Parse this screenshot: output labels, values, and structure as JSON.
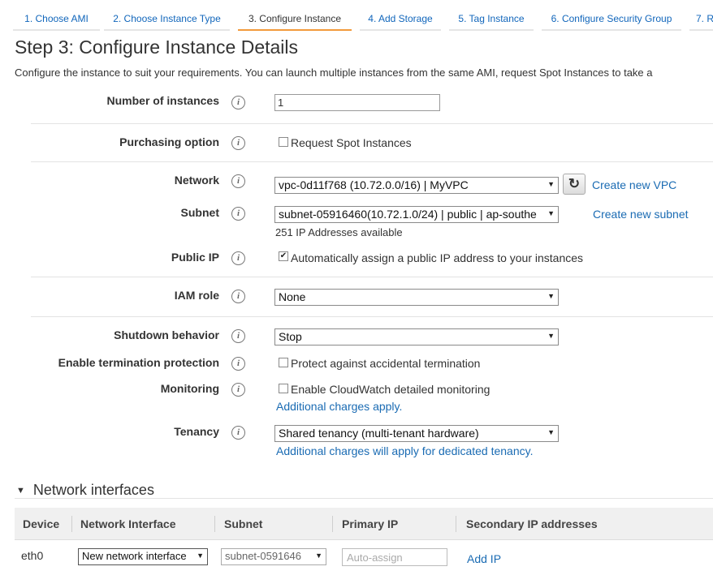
{
  "wizard_tabs": [
    {
      "label": "1. Choose AMI"
    },
    {
      "label": "2. Choose Instance Type"
    },
    {
      "label": "3. Configure Instance"
    },
    {
      "label": "4. Add Storage"
    },
    {
      "label": "5. Tag Instance"
    },
    {
      "label": "6. Configure Security Group"
    },
    {
      "label": "7. R"
    }
  ],
  "page": {
    "title": "Step 3: Configure Instance Details",
    "description": "Configure the instance to suit your requirements. You can launch multiple instances from the same AMI, request Spot Instances to take a"
  },
  "form": {
    "number_of_instances": {
      "label": "Number of instances",
      "value": "1"
    },
    "purchasing_option": {
      "label": "Purchasing option",
      "checkbox_label": "Request Spot Instances",
      "checked": false
    },
    "network": {
      "label": "Network",
      "selected": "vpc-0d11f768 (10.72.0.0/16) | MyVPC",
      "create_link": "Create new VPC"
    },
    "subnet": {
      "label": "Subnet",
      "selected": "subnet-05916460(10.72.1.0/24) | public | ap-southe",
      "create_link": "Create new subnet",
      "available": "251 IP Addresses available"
    },
    "public_ip": {
      "label": "Public IP",
      "checkbox_label": "Automatically assign a public IP address to your instances",
      "checked": true
    },
    "iam_role": {
      "label": "IAM role",
      "selected": "None"
    },
    "shutdown_behavior": {
      "label": "Shutdown behavior",
      "selected": "Stop"
    },
    "termination_protection": {
      "label": "Enable termination protection",
      "checkbox_label": "Protect against accidental termination",
      "checked": false
    },
    "monitoring": {
      "label": "Monitoring",
      "checkbox_label": "Enable CloudWatch detailed monitoring",
      "checked": false,
      "note_link": "Additional charges apply."
    },
    "tenancy": {
      "label": "Tenancy",
      "selected": "Shared tenancy (multi-tenant hardware)",
      "note_link": "Additional charges will apply for dedicated tenancy."
    }
  },
  "network_interfaces": {
    "title": "Network interfaces",
    "columns": [
      "Device",
      "Network Interface",
      "Subnet",
      "Primary IP",
      "Secondary IP addresses"
    ],
    "rows": [
      {
        "device": "eth0",
        "interface": "New network interface",
        "subnet": "subnet-0591646",
        "primary_ip_placeholder": "Auto-assign",
        "secondary_link": "Add IP"
      }
    ]
  },
  "info_glyph": "i",
  "checkmark_glyph": "✔",
  "dropdown_glyph": "▼",
  "refresh_glyph": "↻",
  "collapse_glyph": "▼",
  "colors": {
    "link": "#1a6bb3",
    "active_tab_underline": "#f29a3c"
  }
}
